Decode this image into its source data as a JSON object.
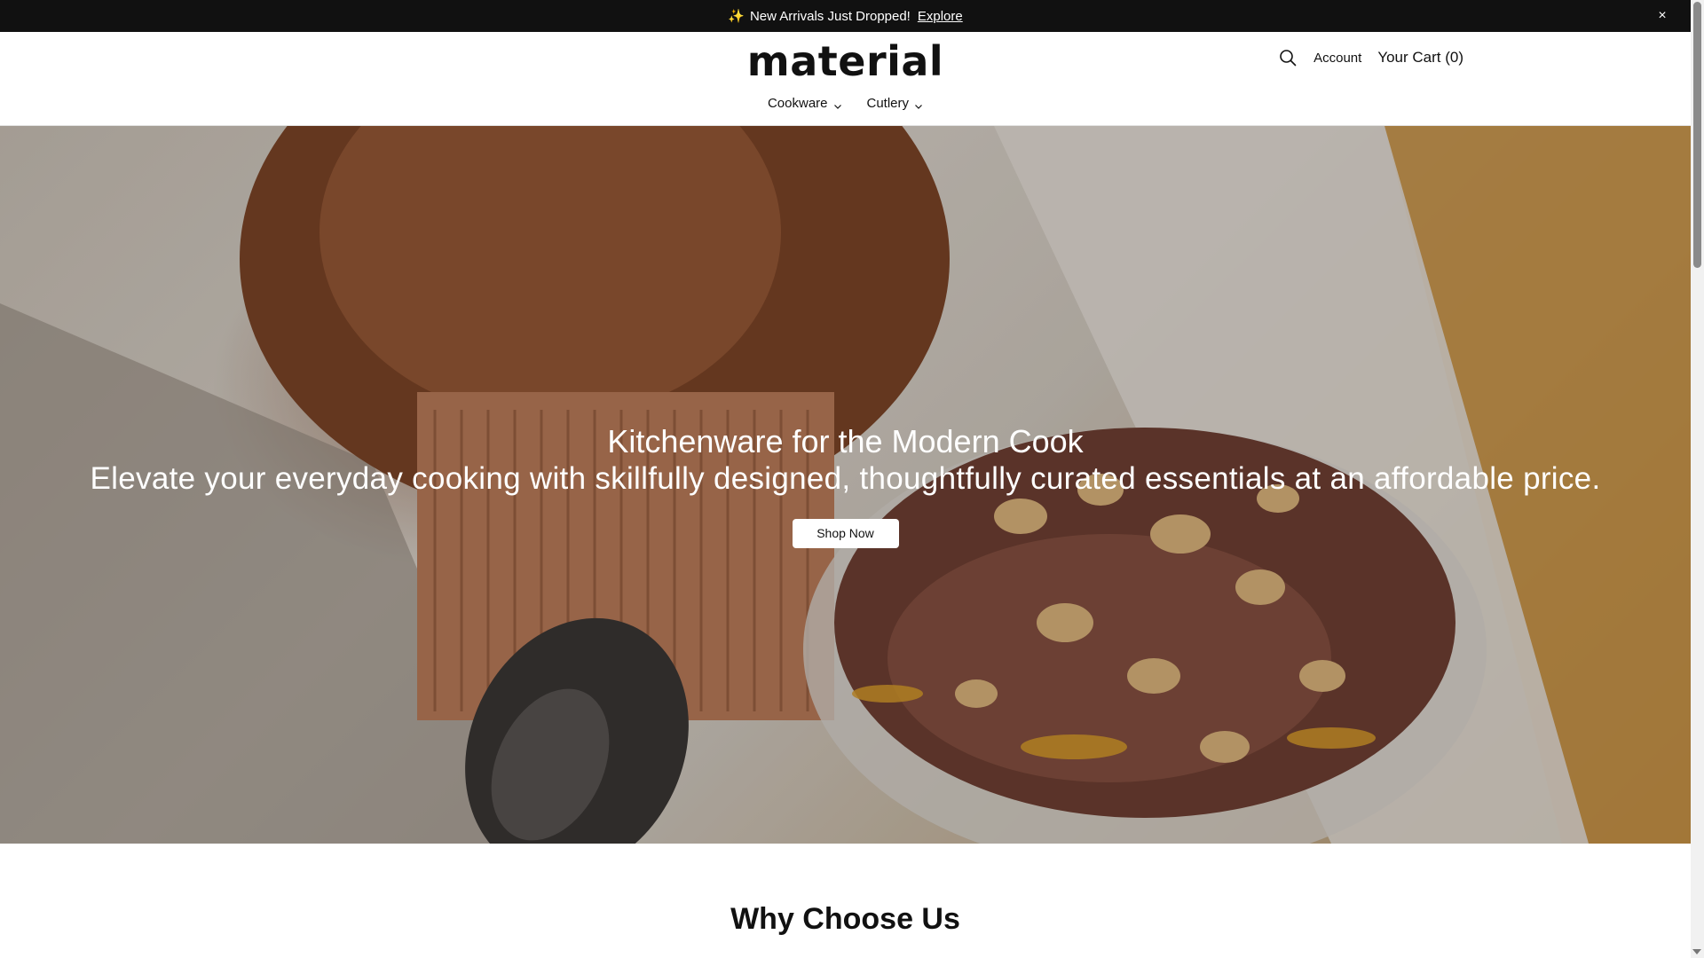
{
  "announcement": {
    "sparkle": "✨",
    "text": "New Arrivals Just Dropped!",
    "link_label": "Explore",
    "close_symbol": "×"
  },
  "header": {
    "logo": "material",
    "search_icon": "search-icon",
    "account_label": "Account",
    "cart_label": "Your Cart (0)"
  },
  "nav": {
    "items": [
      {
        "label": "Cookware",
        "icon": "chevron-down-icon"
      },
      {
        "label": "Cutlery",
        "icon": "chevron-down-icon"
      }
    ]
  },
  "hero": {
    "title": "Kitchenware for the Modern Cook",
    "subtitle": "Elevate your everyday cooking with skillfully designed, thoughtfully curated essentials at an affordable price.",
    "cta_label": "Shop Now"
  },
  "section": {
    "heading": "Why Choose Us"
  },
  "colors": {
    "announcement_bg": "#111111",
    "text": "#111111",
    "hero_text": "#ffffff"
  }
}
